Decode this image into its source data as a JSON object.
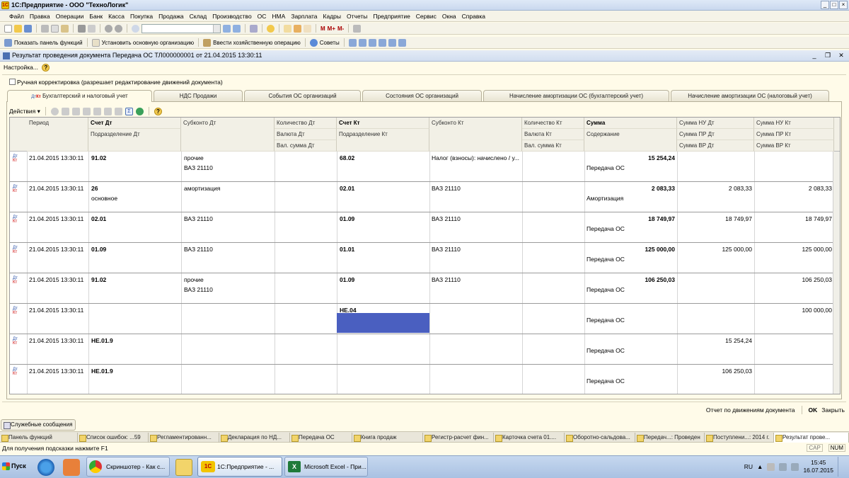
{
  "window": {
    "title": "1С:Предприятие - ООО \"ТехноЛогик\""
  },
  "menu": [
    "Файл",
    "Правка",
    "Операции",
    "Банк",
    "Касса",
    "Покупка",
    "Продажа",
    "Склад",
    "Производство",
    "ОС",
    "НМА",
    "Зарплата",
    "Кадры",
    "Отчеты",
    "Предприятие",
    "Сервис",
    "Окна",
    "Справка"
  ],
  "toolbar2": {
    "show_panel": "Показать панель функций",
    "set_org": "Установить основную организацию",
    "enter_op": "Ввести хозяйственную операцию",
    "tips": "Советы"
  },
  "toolbar1": {
    "m": "M",
    "mplus": "M+",
    "mminus": "M-"
  },
  "document": {
    "title": "Результат проведения документа Передача ОС ТЛ000000001 от 21.04.2015 13:30:11",
    "settings": "Настройка...",
    "manual_correction": "Ручная корректировка (разрешает редактирование движений документа)"
  },
  "tabs": [
    "Бухгалтерский и налоговый учет",
    "НДС Продажи",
    "События ОС организаций",
    "Состояния ОС организаций",
    "Начисление амортизации ОС (бухгалтерский учет)",
    "Начисление амортизации ОС (налоговый учет)"
  ],
  "actions": {
    "label": "Действия"
  },
  "columns": {
    "period": "Период",
    "dt_account": "Счет Дт",
    "dt_dept": "Подразделение Дт",
    "dt_subconto": "Субконто Дт",
    "dt_qty": "Количество Дт",
    "dt_currency": "Валюта Дт",
    "dt_cur_sum": "Вал. сумма Дт",
    "kt_account": "Счет Кт",
    "kt_dept": "Подразделение Кт",
    "kt_subconto": "Субконто Кт",
    "kt_qty": "Количество Кт",
    "kt_currency": "Валюта Кт",
    "kt_cur_sum": "Вал. сумма Кт",
    "sum": "Сумма",
    "content": "Содержание",
    "nu_dt": "Сумма НУ Дт",
    "pr_dt": "Сумма ПР Дт",
    "vr_dt": "Сумма ВР Дт",
    "nu_kt": "Сумма НУ Кт",
    "pr_kt": "Сумма ПР Кт",
    "vr_kt": "Сумма ВР Кт"
  },
  "rows": [
    {
      "period": "21.04.2015 13:30:11",
      "dt_account": "91.02",
      "dt_dept": "",
      "dt_sub1": "прочие",
      "dt_sub2": "ВАЗ 21110",
      "kt_account": "68.02",
      "kt_sub1": "Налог (взносы): начислено / у...",
      "sum": "15 254,24",
      "content": "Передача ОС",
      "nu_dt": "",
      "nu_kt": ""
    },
    {
      "period": "21.04.2015 13:30:11",
      "dt_account": "26",
      "dt_dept": "основное",
      "dt_sub1": "амортизация",
      "dt_sub2": "",
      "kt_account": "02.01",
      "kt_sub1": "ВАЗ 21110",
      "sum": "2 083,33",
      "content": "Амортизация",
      "nu_dt": "2 083,33",
      "nu_kt": "2 083,33"
    },
    {
      "period": "21.04.2015 13:30:11",
      "dt_account": "02.01",
      "dt_dept": "",
      "dt_sub1": "ВАЗ 21110",
      "dt_sub2": "",
      "kt_account": "01.09",
      "kt_sub1": "ВАЗ 21110",
      "sum": "18 749,97",
      "content": "Передача ОС",
      "nu_dt": "18 749,97",
      "nu_kt": "18 749,97"
    },
    {
      "period": "21.04.2015 13:30:11",
      "dt_account": "01.09",
      "dt_dept": "",
      "dt_sub1": "ВАЗ 21110",
      "dt_sub2": "",
      "kt_account": "01.01",
      "kt_sub1": "ВАЗ 21110",
      "sum": "125 000,00",
      "content": "Передача ОС",
      "nu_dt": "125 000,00",
      "nu_kt": "125 000,00"
    },
    {
      "period": "21.04.2015 13:30:11",
      "dt_account": "91.02",
      "dt_dept": "",
      "dt_sub1": "прочие",
      "dt_sub2": "ВАЗ 21110",
      "kt_account": "01.09",
      "kt_sub1": "ВАЗ 21110",
      "sum": "106 250,03",
      "content": "Передача ОС",
      "nu_dt": "",
      "nu_kt": "106 250,03"
    },
    {
      "period": "21.04.2015 13:30:11",
      "dt_account": "",
      "dt_dept": "",
      "dt_sub1": "",
      "dt_sub2": "",
      "kt_account": "НЕ.04",
      "kt_sub1": "",
      "sum": "",
      "content": "Передача ОС",
      "nu_dt": "",
      "nu_kt": "100 000,00"
    },
    {
      "period": "21.04.2015 13:30:11",
      "dt_account": "НЕ.01.9",
      "dt_dept": "",
      "dt_sub1": "",
      "dt_sub2": "",
      "kt_account": "",
      "kt_sub1": "",
      "sum": "",
      "content": "Передача ОС",
      "nu_dt": "15 254,24",
      "nu_kt": ""
    },
    {
      "period": "21.04.2015 13:30:11",
      "dt_account": "НЕ.01.9",
      "dt_dept": "",
      "dt_sub1": "",
      "dt_sub2": "",
      "kt_account": "",
      "kt_sub1": "",
      "sum": "",
      "content": "Передача ОС",
      "nu_dt": "106 250,03",
      "nu_kt": ""
    }
  ],
  "footer": {
    "report": "Отчет по движениям документа",
    "ok": "OK",
    "close": "Закрыть"
  },
  "service_messages": "Служебные сообщения",
  "windows": [
    "Панель функций",
    "Список ошибок: ...59",
    "Регламентированн...",
    "Декларация по НД...",
    "Передача ОС",
    "Книга продаж",
    "Регистр-расчет фин...",
    "Карточка счета 01....",
    "Оборотно-сальдова...",
    "Передач...: Проведен",
    "Поступлени...: 2014 г.",
    "Результат прове..."
  ],
  "status": {
    "hint": "Для получения подсказки нажмите F1",
    "cap": "CAP",
    "num": "NUM"
  },
  "taskbar": {
    "start": "Пуск",
    "items": [
      "Скриншотер - Как с...",
      "1С:Предприятие - ...",
      "Microsoft Excel - При..."
    ],
    "lang": "RU",
    "time": "15:45",
    "date": "16.07.2015"
  }
}
